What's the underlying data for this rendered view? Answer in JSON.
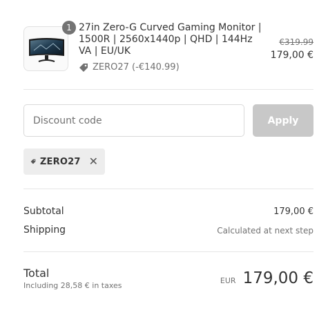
{
  "product": {
    "quantity": "1",
    "name": "27in Zero-G Curved Gaming Monitor | 1500R | 2560x1440p | QHD | 144Hz VA | EU/UK",
    "discount_line": "ZERO27 (-€140.99)",
    "original_price": "€319.99",
    "price": "179,00 €"
  },
  "discount": {
    "placeholder": "Discount code",
    "apply_label": "Apply",
    "applied_code": "ZERO27"
  },
  "summary": {
    "subtotal_label": "Subtotal",
    "subtotal_value": "179,00 €",
    "shipping_label": "Shipping",
    "shipping_value": "Calculated at next step",
    "total_label": "Total",
    "tax_note": "Including 28,58 € in taxes",
    "currency": "EUR",
    "total_value": "179,00 €"
  },
  "colors": {
    "badge": "#737373",
    "apply_disabled": "#c8c8c8",
    "chip_bg": "#ededed",
    "muted_text": "#717171"
  },
  "icons": [
    "monitor-thumbnail",
    "tag-icon",
    "close-icon"
  ]
}
